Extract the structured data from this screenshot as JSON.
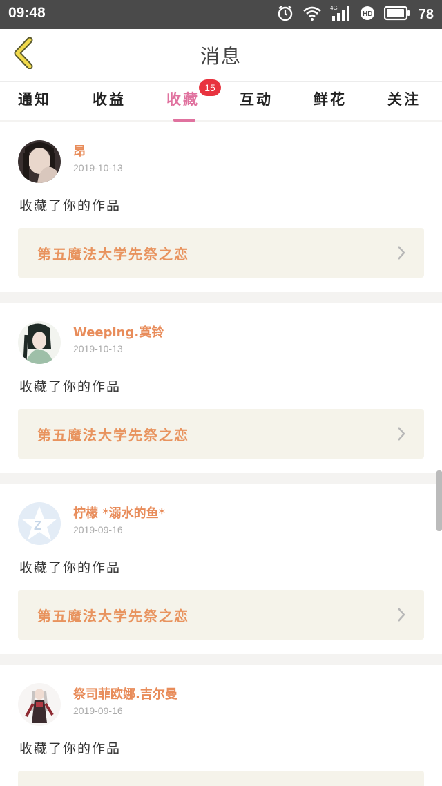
{
  "status_bar": {
    "time": "09:48",
    "battery": "78",
    "icons": [
      "alarm-icon",
      "wifi-icon",
      "signal-4g-icon",
      "hd-icon",
      "battery-icon"
    ]
  },
  "header": {
    "title": "消息",
    "back_icon": "chevron-left-icon",
    "accent": "#f1d94b"
  },
  "tabs": [
    {
      "label": "通知",
      "active": false
    },
    {
      "label": "收益",
      "active": false
    },
    {
      "label": "收藏",
      "active": true,
      "badge": "15"
    },
    {
      "label": "互动",
      "active": false
    },
    {
      "label": "鲜花",
      "active": false
    },
    {
      "label": "关注",
      "active": false
    }
  ],
  "colors": {
    "active_tab": "#e0729f",
    "badge": "#e8333f",
    "username": "#e88c5a",
    "work_title": "#e8935e",
    "work_bg": "#f5f3ea"
  },
  "feed": [
    {
      "user": "昂",
      "date": "2019-10-13",
      "action": "收藏了你的作品",
      "work_title": "第五魔法大学先祭之恋"
    },
    {
      "user": "Weeping.寞铃",
      "date": "2019-10-13",
      "action": "收藏了你的作品",
      "work_title": "第五魔法大学先祭之恋"
    },
    {
      "user": "柠檬 *溺水的鱼*",
      "date": "2019-09-16",
      "action": "收藏了你的作品",
      "work_title": "第五魔法大学先祭之恋"
    },
    {
      "user": "祭司菲欧娜.吉尔曼",
      "date": "2019-09-16",
      "action": "收藏了你的作品",
      "work_title": ""
    }
  ]
}
